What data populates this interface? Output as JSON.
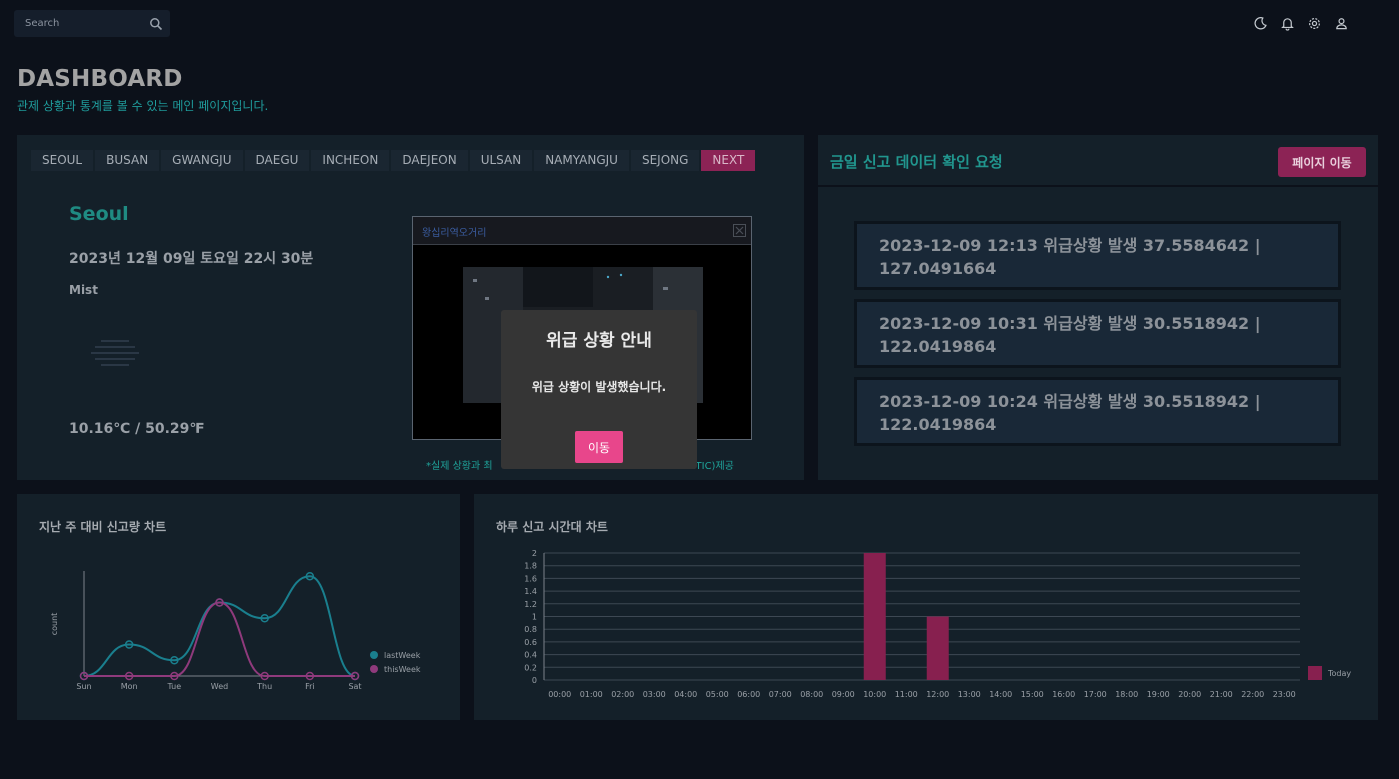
{
  "search": {
    "placeholder": "Search"
  },
  "header": {
    "icons": [
      "moon-icon",
      "bell-icon",
      "gear-icon",
      "user-icon"
    ]
  },
  "page": {
    "title": "DASHBOARD",
    "subtitle": "관제 상황과 통계를 볼 수 있는 메인 페이지입니다."
  },
  "weather": {
    "tabs": [
      "SEOUL",
      "BUSAN",
      "GWANGJU",
      "DAEGU",
      "INCHEON",
      "DAEJEON",
      "ULSAN",
      "NAMYANGJU",
      "SEJONG",
      "NEXT"
    ],
    "city": "Seoul",
    "datetime": "2023년 12월 09일 토요일 22시 30분",
    "description": "Mist",
    "temperature": "10.16℃ / 50.29℉",
    "cctv_title": "왕십리역오거리",
    "cctv_caption": "*실제 상황과 최",
    "cctv_caption_tail": "ITIC)제공"
  },
  "reports": {
    "title": "금일 신고 데이터 확인 요청",
    "button_label": "페이지 이동",
    "items": [
      "2023-12-09 12:13 위급상황 발생 37.5584642 | 127.0491664",
      "2023-12-09 10:31 위급상황 발생 30.5518942 | 122.0419864",
      "2023-12-09 10:24 위급상황 발생 30.5518942 | 122.0419864"
    ]
  },
  "weekly_chart": {
    "title": "지난 주 대비 신고량 차트"
  },
  "hourly_chart": {
    "title": "하루 신고 시간대 차트"
  },
  "modal": {
    "title": "위급 상황 안내",
    "message": "위급 상황이 발생했습니다.",
    "button_label": "이동"
  },
  "colors": {
    "accent_teal": "#1f8b82",
    "accent_pink": "#8c2355",
    "modal_button": "#e8468b",
    "line_last_week": "#1a7f8e",
    "line_this_week": "#8f3a7c",
    "bar_today": "#87204f"
  },
  "chart_data": [
    {
      "type": "line",
      "title": "",
      "categories": [
        "Sun",
        "Mon",
        "Tue",
        "Wed",
        "Thu",
        "Fri",
        "Sat"
      ],
      "ylabel": "count",
      "series": [
        {
          "name": "lastWeek",
          "values": [
            0,
            0.6,
            0.3,
            1.4,
            1.1,
            1.9,
            0
          ]
        },
        {
          "name": "thisWeek",
          "values": [
            0,
            0,
            0,
            1.4,
            0,
            0,
            0
          ]
        }
      ],
      "legend": "right"
    },
    {
      "type": "bar",
      "title": "",
      "categories": [
        "00:00",
        "01:00",
        "02:00",
        "03:00",
        "04:00",
        "05:00",
        "06:00",
        "07:00",
        "08:00",
        "09:00",
        "10:00",
        "11:00",
        "12:00",
        "13:00",
        "14:00",
        "15:00",
        "16:00",
        "17:00",
        "18:00",
        "19:00",
        "20:00",
        "21:00",
        "22:00",
        "23:00"
      ],
      "series": [
        {
          "name": "Today",
          "values": [
            0,
            0,
            0,
            0,
            0,
            0,
            0,
            0,
            0,
            0,
            2,
            0,
            1,
            0,
            0,
            0,
            0,
            0,
            0,
            0,
            0,
            0,
            0,
            0
          ]
        }
      ],
      "yticks": [
        "0",
        "0.2",
        "0.4",
        "0.6",
        "0.8",
        "1",
        "1.2",
        "1.4",
        "1.6",
        "1.8",
        "2"
      ],
      "ylim": [
        0,
        2
      ],
      "grid": true,
      "legend": "right"
    }
  ]
}
